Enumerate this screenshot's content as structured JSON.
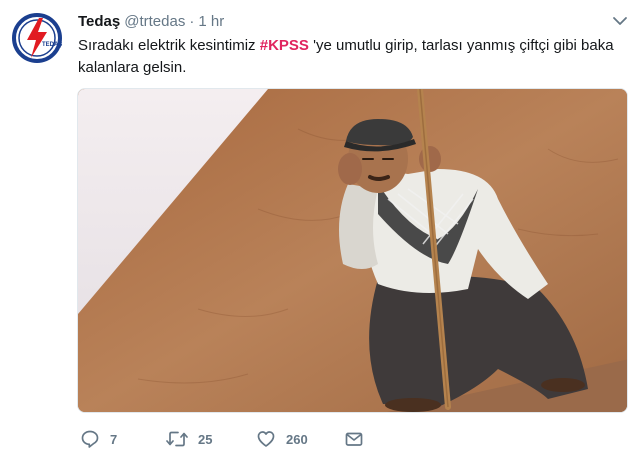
{
  "account": {
    "name": "Tedaş",
    "handle": "@trtedas",
    "separator": "·",
    "time": "1 hr",
    "avatar_logo": {
      "text": "TEDAŞ",
      "colors": {
        "ring": "#1b3f8f",
        "bolt": "#e11b22"
      }
    }
  },
  "tweet": {
    "text_before": "Sıradakı elektrik kesintimiz ",
    "hashtag": "#KPSS",
    "text_after": " 'ye umutlu girip, tarlası yanmış çiftçi gibi baka kalanlara gelsin."
  },
  "media": {
    "description_icon": "photo-man-squatting-with-stick"
  },
  "actions": {
    "reply": {
      "icon": "reply-icon",
      "count": "7"
    },
    "retweet": {
      "icon": "retweet-icon",
      "count": "25"
    },
    "like": {
      "icon": "heart-icon",
      "count": "260"
    },
    "dm": {
      "icon": "envelope-icon"
    }
  },
  "colors": {
    "hashtag": "#e0245e",
    "muted": "#657786",
    "text": "#14171a"
  }
}
